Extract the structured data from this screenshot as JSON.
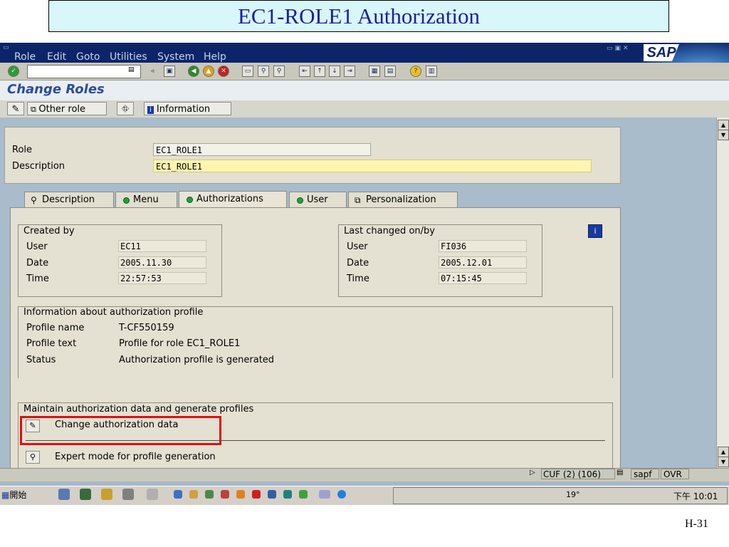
{
  "slide": {
    "title": "EC1-ROLE1  Authorization",
    "page_number": "H-31"
  },
  "menu": [
    "Role",
    "Edit",
    "Goto",
    "Utilities",
    "System",
    "Help"
  ],
  "sap_logo": "SAP",
  "page_title": "Change Roles",
  "app_toolbar": {
    "other_role": "Other role",
    "information": "Information"
  },
  "header": {
    "role_label": "Role",
    "role_value": "EC1_ROLE1",
    "description_label": "Description",
    "description_value": "EC1_ROLE1"
  },
  "tabs": [
    "Description",
    "Menu",
    "Authorizations",
    "User",
    "Personalization"
  ],
  "created_by": {
    "title": "Created by",
    "user_label": "User",
    "user_value": "EC11",
    "date_label": "Date",
    "date_value": "2005.11.30",
    "time_label": "Time",
    "time_value": "22:57:53"
  },
  "last_changed": {
    "title": "Last changed on/by",
    "user_label": "User",
    "user_value": "FI036",
    "date_label": "Date",
    "date_value": "2005.12.01",
    "time_label": "Time",
    "time_value": "07:15:45"
  },
  "profile_info": {
    "title": "Information about authorization profile",
    "name_label": "Profile name",
    "name_value": "T-CF550159",
    "text_label": "Profile text",
    "text_value": "Profile for role EC1_ROLE1",
    "status_label": "Status",
    "status_value": "Authorization profile is generated"
  },
  "maintain": {
    "title": "Maintain authorization data and generate profiles",
    "change_auth": "Change authorization data",
    "expert_mode": "Expert mode for profile generation"
  },
  "status_bar": {
    "system": "CUF (2) (106)",
    "server": "sapf",
    "mode": "OVR"
  },
  "taskbar": {
    "start": "開始",
    "clock": "下午 10:01",
    "temperature": "19°"
  },
  "colors": {
    "highlight_box": "#e01010",
    "menubar": "#0c2568",
    "title_text": "#1b1ea9"
  }
}
